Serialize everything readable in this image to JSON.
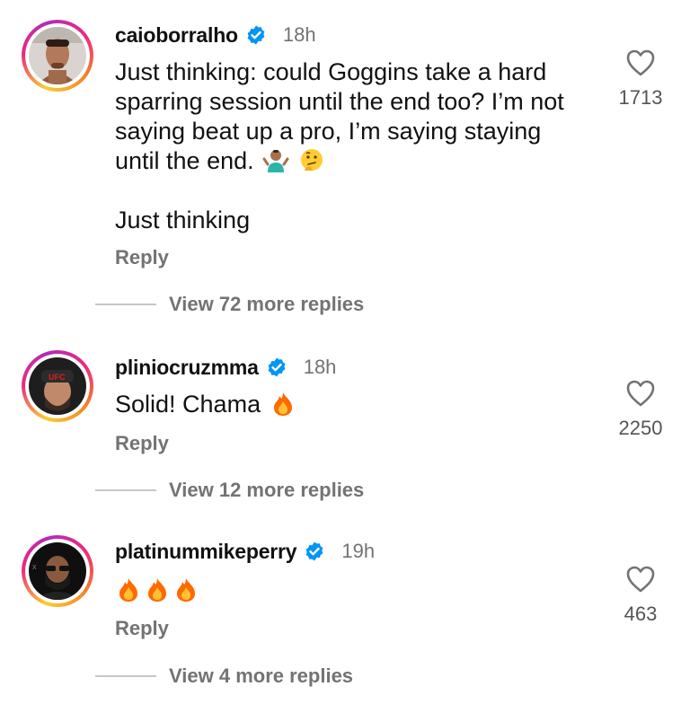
{
  "comments": [
    {
      "username": "caioborralho",
      "verified": true,
      "time": "18h",
      "text_lines": [
        "Just thinking: could Goggins take a hard",
        "sparring session until the end too? I’m not",
        "saying beat up a pro, I’m saying staying",
        "until the end."
      ],
      "emojis": [
        "person-shrugging-emoji",
        "thinking-face-emoji"
      ],
      "text_extra": "Just thinking",
      "reply_label": "Reply",
      "more_replies": "View 72 more replies",
      "likes": "1713"
    },
    {
      "username": "pliniocruzmma",
      "verified": true,
      "time": "18h",
      "text": "Solid! Chama",
      "emojis": [
        "fire-emoji"
      ],
      "reply_label": "Reply",
      "more_replies": "View 12 more replies",
      "likes": "2250"
    },
    {
      "username": "platinummikeperry",
      "verified": true,
      "time": "19h",
      "emojis": [
        "fire-emoji",
        "fire-emoji",
        "fire-emoji"
      ],
      "reply_label": "Reply",
      "more_replies": "View 4 more replies",
      "likes": "463"
    }
  ],
  "colors": {
    "verified_badge": "#0095f6",
    "secondary_text": "#737373",
    "primary_text": "#111111"
  }
}
